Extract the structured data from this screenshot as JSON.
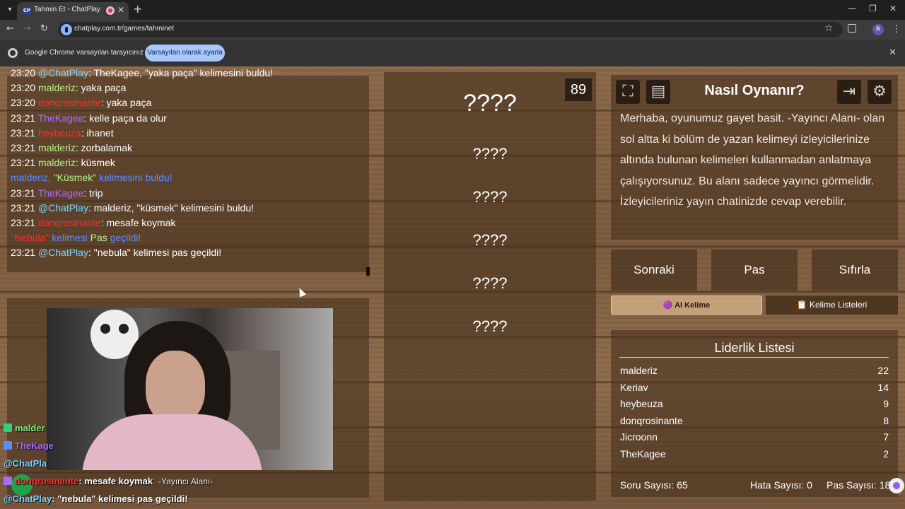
{
  "browser": {
    "tab_favicon": "CP",
    "tab_title": "Tahmin Et - ChatPlay",
    "url": "chatplay.com.tr/games/tahminet",
    "profile_initial": "R",
    "infobar_text": "Google Chrome varsayılan tarayıcınız değil",
    "infobar_button": "Varsayılan olarak ayarla",
    "icons": [
      "tab-list-icon",
      "recording-icon",
      "close-icon",
      "new-tab-icon",
      "minimize-icon",
      "maximize-icon",
      "back-icon",
      "forward-icon",
      "reload-icon",
      "site-info-icon",
      "bookmark-star-icon",
      "extensions-icon",
      "profile-icon",
      "menu-icon",
      "chrome-icon"
    ]
  },
  "chat": {
    "lines": [
      {
        "time": "23:20",
        "user": "@ChatPlay",
        "msg": ": TheKagee, \"yaka paça\" kelimesini buldu!"
      },
      {
        "time": "23:20",
        "user": "malderiz",
        "msg": ": yaka paça"
      },
      {
        "time": "23:20",
        "user": "donqrosinante",
        "msg": ": yaka paça"
      },
      {
        "time": "23:21",
        "user": "TheKagee",
        "msg": ": kelle paça da olur"
      },
      {
        "time": "23:21",
        "user": "heybeuza",
        "msg": ": ihanet"
      },
      {
        "time": "23:21",
        "user": "malderiz",
        "msg": ": zorbalamak"
      },
      {
        "time": "23:21",
        "user": "malderiz",
        "msg": ": küsmek"
      },
      {
        "system_prefix": "malderiz, ",
        "system_word": "\"Küsmek\"",
        "system_suffix": " kelimesini buldu!"
      },
      {
        "time": "23:21",
        "user": "TheKagee",
        "msg": ": trip"
      },
      {
        "time": "23:21",
        "user": "@ChatPlay",
        "msg": ": malderiz, \"küsmek\" kelimesini buldu!"
      },
      {
        "time": "23:21",
        "user": "donqrosinante",
        "msg": ": mesafe koymak"
      },
      {
        "system_word2": "\"Nebula\"",
        "system_mid": " kelimesi ",
        "system_pas": "Pas",
        "system_end": " geçildi!"
      },
      {
        "time": "23:21",
        "user": "@ChatPlay",
        "msg": ": \"nebula\" kelimesi pas geçildi!"
      }
    ]
  },
  "overlay_chat": {
    "lines": [
      {
        "user": "malder",
        "msg": ""
      },
      {
        "user": "TheKage",
        "msg": ""
      },
      {
        "user": "@ChatPla",
        "msg": ""
      },
      {
        "user": "donqrosinante",
        "msg": ": mesafe koymak",
        "sub": "-Yayıncı Alanı-"
      },
      {
        "user": "@ChatPlay",
        "msg": ": \"nebula\" kelimesi pas geçildi!"
      }
    ]
  },
  "game": {
    "timer": "89",
    "main_word": "????",
    "hidden_words": [
      "????",
      "????",
      "????",
      "????",
      "????"
    ]
  },
  "help": {
    "title": "Nasıl Oynanır?",
    "body": "Merhaba, oyunumuz gayet basit. -Yayıncı Alanı- olan sol altta ki bölüm de yazan kelimeyi izleyicilerinize altında bulunan kelimeleri kullanmadan anlatmaya çalışıyorsunuz. Bu alanı sadece yayıncı görmelidir. İzleyicileriniz yayın chatinizde cevap verebilir.",
    "header_icons": [
      "fullscreen-icon",
      "notes-icon",
      "exit-icon",
      "settings-gear-icon"
    ]
  },
  "controls": {
    "next": "Sonraki",
    "pass": "Pas",
    "reset": "Sıfırla",
    "ai_tab": "🟣 AI Kelime",
    "list_tab": "📋 Kelime Listeleri"
  },
  "leaderboard": {
    "title": "Liderlik Listesi",
    "rows": [
      {
        "name": "malderiz",
        "score": "22"
      },
      {
        "name": "Keriav",
        "score": "14"
      },
      {
        "name": "heybeuza",
        "score": "9"
      },
      {
        "name": "donqrosinante",
        "score": "8"
      },
      {
        "name": "Jicroonn",
        "score": "7"
      },
      {
        "name": "TheKagee",
        "score": "2"
      }
    ],
    "stats": {
      "questions_label": "Soru Sayısı:",
      "questions": "65",
      "errors_label": "Hata Sayısı:",
      "errors": "0",
      "passes_label": "Pas Sayısı:",
      "passes": "18"
    }
  }
}
